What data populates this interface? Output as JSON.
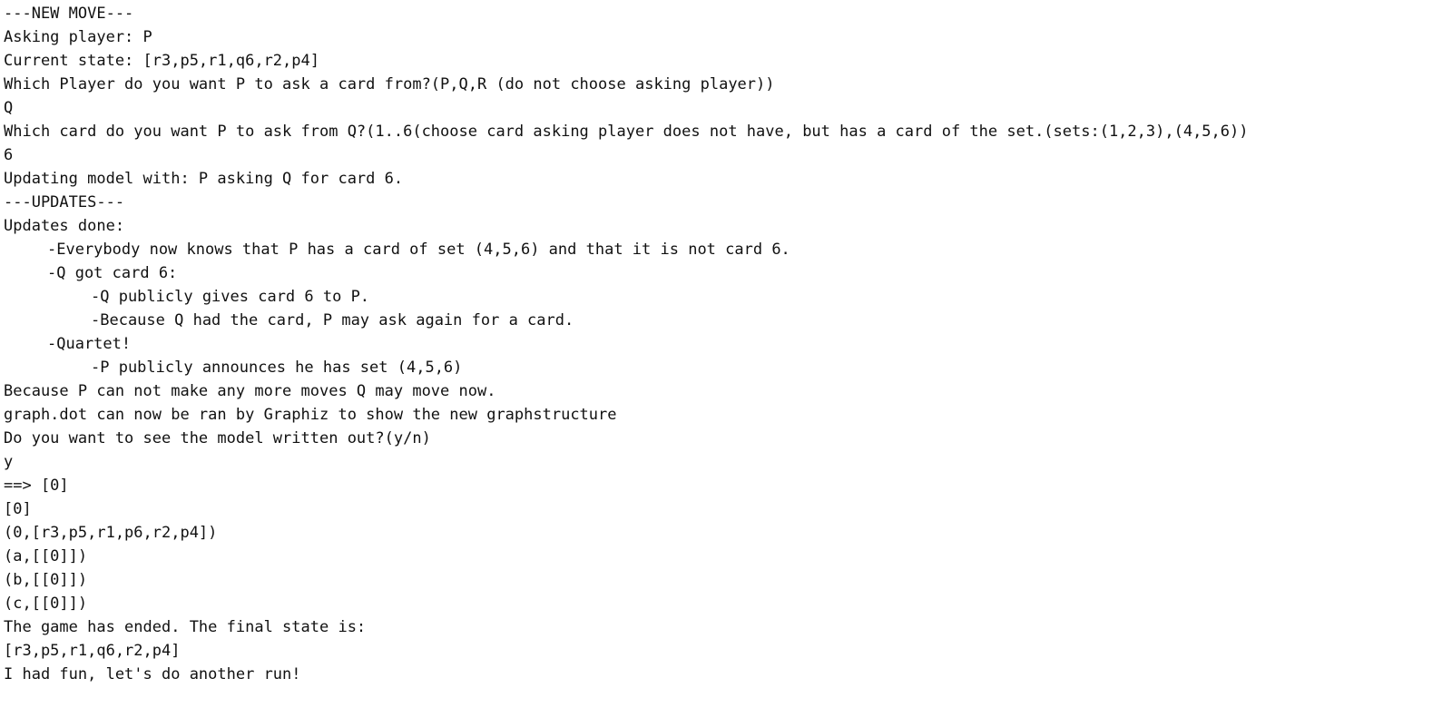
{
  "console": {
    "lines": [
      {
        "text": "---NEW MOVE---",
        "indent": 0
      },
      {
        "text": "Asking player: P",
        "indent": 0
      },
      {
        "text": "Current state: [r3,p5,r1,q6,r2,p4]",
        "indent": 0
      },
      {
        "text": "Which Player do you want P to ask a card from?(P,Q,R (do not choose asking player))",
        "indent": 0
      },
      {
        "text": "Q",
        "indent": 0
      },
      {
        "text": "Which card do you want P to ask from Q?(1..6(choose card asking player does not have, but has a card of the set.(sets:(1,2,3),(4,5,6))",
        "indent": 0
      },
      {
        "text": "6",
        "indent": 0
      },
      {
        "text": "Updating model with: P asking Q for card 6.",
        "indent": 0
      },
      {
        "text": "---UPDATES---",
        "indent": 0
      },
      {
        "text": "Updates done:",
        "indent": 0
      },
      {
        "text": "-Everybody now knows that P has a card of set (4,5,6) and that it is not card 6.",
        "indent": 1
      },
      {
        "text": "-Q got card 6:",
        "indent": 1
      },
      {
        "text": "-Q publicly gives card 6 to P.",
        "indent": 2
      },
      {
        "text": "-Because Q had the card, P may ask again for a card.",
        "indent": 2
      },
      {
        "text": "-Quartet!",
        "indent": 1
      },
      {
        "text": "-P publicly announces he has set (4,5,6)",
        "indent": 2
      },
      {
        "text": "Because P can not make any more moves Q may move now.",
        "indent": 0
      },
      {
        "text": "graph.dot can now be ran by Graphiz to show the new graphstructure",
        "indent": 0
      },
      {
        "text": "Do you want to see the model written out?(y/n)",
        "indent": 0
      },
      {
        "text": "y",
        "indent": 0
      },
      {
        "text": "==> [0]",
        "indent": 0
      },
      {
        "text": "[0]",
        "indent": 0
      },
      {
        "text": "(0,[r3,p5,r1,p6,r2,p4])",
        "indent": 0
      },
      {
        "text": "(a,[[0]])",
        "indent": 0
      },
      {
        "text": "(b,[[0]])",
        "indent": 0
      },
      {
        "text": "(c,[[0]])",
        "indent": 0
      },
      {
        "text": "The game has ended. The final state is:",
        "indent": 0
      },
      {
        "text": "[r3,p5,r1,q6,r2,p4]",
        "indent": 0
      },
      {
        "text": "I had fun, let's do another run!",
        "indent": 0
      }
    ]
  }
}
